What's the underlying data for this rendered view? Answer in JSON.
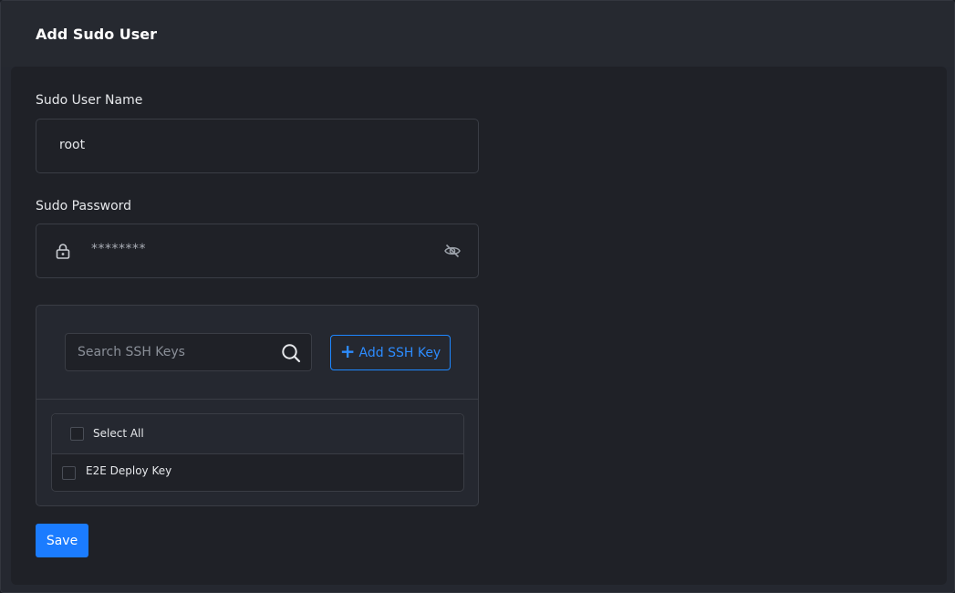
{
  "header": {
    "title": "Add Sudo User"
  },
  "form": {
    "username": {
      "label": "Sudo User Name",
      "value": "root"
    },
    "password": {
      "label": "Sudo Password",
      "masked_value": "********",
      "visibility_icon": "eye-off-icon"
    },
    "ssh_keys": {
      "search_placeholder": "Search SSH Keys",
      "add_button_label": "Add SSH Key",
      "select_all_label": "Select All",
      "keys": [
        {
          "name": "E2E Deploy Key",
          "checked": false
        }
      ]
    },
    "save_label": "Save"
  },
  "colors": {
    "accent": "#1b7cff",
    "background": "#1f2127",
    "header_background": "#262930",
    "border": "#3a3d45"
  }
}
